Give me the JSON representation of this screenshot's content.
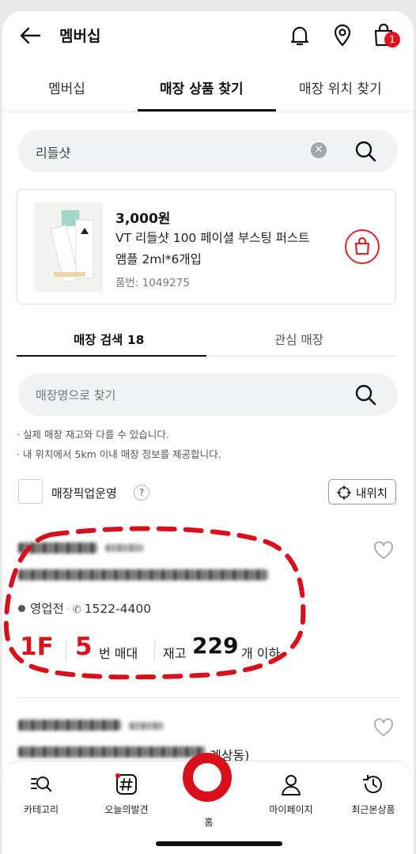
{
  "header": {
    "title": "멤버십",
    "cart_count": "1"
  },
  "tabs": [
    {
      "label": "멤버십",
      "active": false
    },
    {
      "label": "매장 상품 찾기",
      "active": true
    },
    {
      "label": "매장 위치 찾기",
      "active": false
    }
  ],
  "search": {
    "value": "리들샷"
  },
  "product": {
    "price": "3,000원",
    "name": "VT 리들샷 100 페이셜 부스팅 퍼스트 앰플 2ml*6개입",
    "code": "품번: 1049275"
  },
  "store_tabs": {
    "search_label": "매장 검색 18",
    "favorites_label": "관심 매장"
  },
  "store_search": {
    "placeholder": "매장명으로 찾기"
  },
  "notices": [
    "· 실제 매장 재고와 다를 수 있습니다.",
    "· 내 위치에서 5km 이내 매장 정보를 제공합니다."
  ],
  "pickup": {
    "label": "매장픽업운영",
    "help": "?",
    "my_location": "내위치"
  },
  "store1": {
    "status": "영업전",
    "phone": "1522-4400",
    "floor": "1F",
    "shelf_number": "5",
    "shelf_label": "번 매대",
    "stock_label": "재고",
    "stock_value": "229",
    "stock_unit": "개 이하"
  },
  "store2": {
    "address_tail": "계상동)"
  },
  "bottom_nav": [
    {
      "label": "카테고리",
      "icon": "category-search-icon"
    },
    {
      "label": "오늘의발견",
      "icon": "hashtag-icon"
    },
    {
      "label": "홈",
      "icon": "home-icon"
    },
    {
      "label": "마이페이지",
      "icon": "person-icon"
    },
    {
      "label": "최근본상품",
      "icon": "history-icon"
    }
  ],
  "colors": {
    "accent": "#d8141c"
  }
}
